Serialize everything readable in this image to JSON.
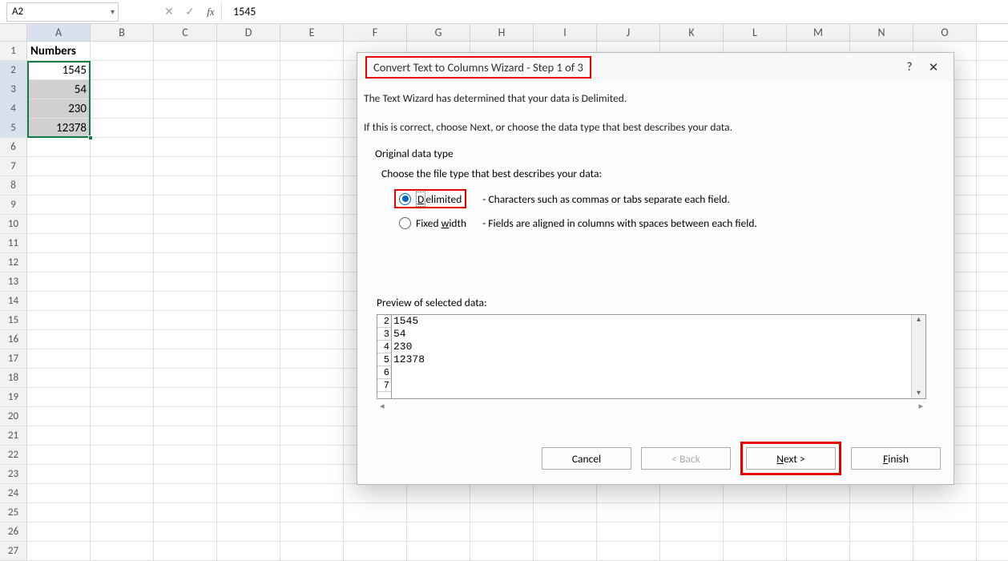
{
  "nameBox": "A2",
  "formulaValue": "1545",
  "columns": [
    "A",
    "B",
    "C",
    "D",
    "E",
    "F",
    "G",
    "H",
    "I",
    "J",
    "K",
    "L",
    "M",
    "N",
    "O"
  ],
  "rowCount": 27,
  "activeCol": 0,
  "activeRows": [
    2,
    3,
    4,
    5
  ],
  "cells": {
    "header": "Numbers",
    "values": [
      "1545",
      "54",
      "230",
      "12378"
    ]
  },
  "dialog": {
    "title": "Convert Text to Columns Wizard - Step 1 of 3",
    "help": "?",
    "close": "✕",
    "line1": "The Text Wizard has determined that your data is Delimited.",
    "line2": "If this is correct, choose Next, or choose the data type that best describes your data.",
    "groupLabel": "Original data type",
    "groupSub": "Choose the file type that best describes your data:",
    "opt1": {
      "pre": "D",
      "text": "elimited",
      "desc": "- Characters such as commas or tabs separate each field."
    },
    "opt2": {
      "text": "Fixed ",
      "ul": "w",
      "post": "idth",
      "desc": "- Fields are aligned in columns with spaces between each field."
    },
    "previewLabel": "Preview of selected data:",
    "previewRows": [
      "2",
      "3",
      "4",
      "5",
      "6",
      "7"
    ],
    "previewData": [
      "1545",
      "54",
      "230",
      "12378",
      "",
      ""
    ],
    "buttons": {
      "cancel": "Cancel",
      "back": "< Back",
      "nextPre": "N",
      "nextPost": "ext >",
      "finishPre": "F",
      "finishPost": "inish"
    }
  }
}
